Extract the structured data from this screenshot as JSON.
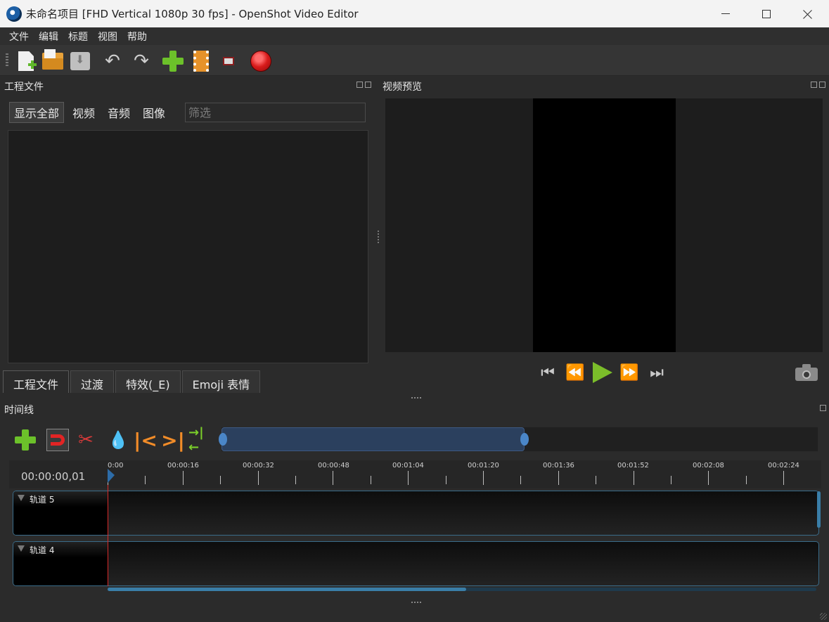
{
  "window": {
    "title": "未命名项目 [FHD Vertical 1080p 30 fps] - OpenShot Video Editor"
  },
  "menu": [
    "文件",
    "编辑",
    "标题",
    "视图",
    "帮助"
  ],
  "toolbar": {
    "icons": [
      "new-project-icon",
      "open-project-icon",
      "save-project-icon",
      "undo-icon",
      "redo-icon",
      "import-files-icon",
      "choose-profile-icon",
      "fullscreen-icon",
      "export-video-icon"
    ]
  },
  "project_files": {
    "title": "工程文件",
    "filters": [
      "显示全部",
      "视频",
      "音频",
      "图像"
    ],
    "filter_placeholder": "筛选",
    "tabs": [
      "工程文件",
      "过渡",
      "特效(_E)",
      "Emoji 表情"
    ]
  },
  "preview": {
    "title": "视频预览"
  },
  "timeline": {
    "title": "时间线",
    "timecode": "00:00:00,01",
    "ruler_labels": [
      "0:00",
      "00:00:16",
      "00:00:32",
      "00:00:48",
      "00:01:04",
      "00:01:20",
      "00:01:36",
      "00:01:52",
      "00:02:08",
      "00:02:24"
    ],
    "tracks": [
      "轨道 5",
      "轨道 4"
    ]
  },
  "colors": {
    "accent_green": "#6cc12a",
    "record_red": "#d81b1b",
    "playhead": "#d82b2b",
    "zoom_range": "#2b405e",
    "track_border": "#3a6c8a"
  }
}
